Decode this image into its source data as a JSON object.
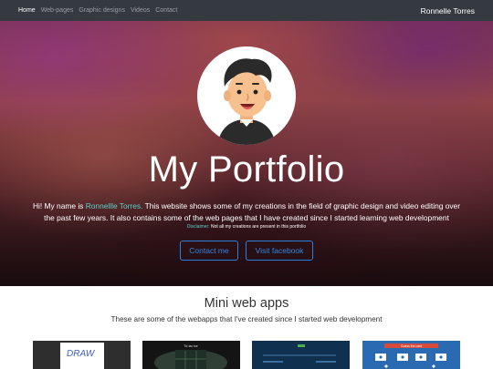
{
  "nav": {
    "links": [
      {
        "label": "Home"
      },
      {
        "label": "Web-pages"
      },
      {
        "label": "Graphic designs"
      },
      {
        "label": "Videos"
      },
      {
        "label": "Contact"
      }
    ],
    "brand": "Ronnelle Torres"
  },
  "hero": {
    "title": "My Portfolio",
    "desc_before": "Hi! My name is ",
    "desc_name": "Ronnellle Torres.",
    "desc_after": " This website shows some of my creations in the field of graphic design and video editing over the past few years. It also contains some of the web pages that I have created since I started learning web development",
    "disclaimer_label": "Disclaimer:",
    "disclaimer_text": " Not all my creations are present in this portfolio",
    "contact_button": "Contact me",
    "facebook_button": "Visit facebook"
  },
  "section": {
    "title": "Mini web apps",
    "subtitle": "These are some of the webapps that I've created since I started web development",
    "thumbs": [
      {
        "text": "DRAW"
      },
      {
        "text": "Tic tac toe"
      },
      {
        "text": ""
      },
      {
        "text": "Guess the card"
      }
    ]
  },
  "colors": {
    "navbar": "#343a40",
    "accent": "#5cd0c8",
    "button": "#2f86df"
  }
}
